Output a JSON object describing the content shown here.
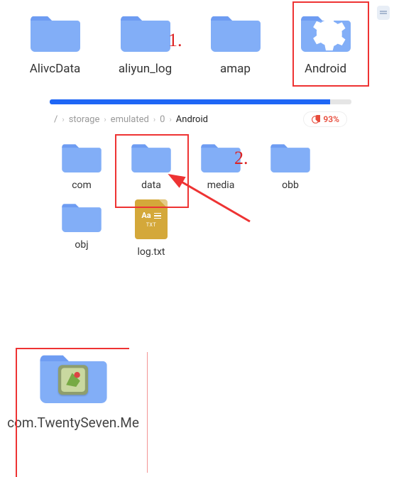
{
  "top_grid": {
    "items": [
      {
        "label": "AlivcData"
      },
      {
        "label": "aliyun_log"
      },
      {
        "label": "amap"
      },
      {
        "label": "Android"
      }
    ]
  },
  "annotations": {
    "one": "1.",
    "two": "2."
  },
  "breadcrumb": {
    "root": "/",
    "c1": "storage",
    "c2": "emulated",
    "c3": "0",
    "c4": "Android"
  },
  "storage": {
    "percent_text": "93%",
    "percent": 93
  },
  "sub_grid": {
    "items": [
      {
        "label": "com",
        "type": "folder"
      },
      {
        "label": "data",
        "type": "folder"
      },
      {
        "label": "media",
        "type": "folder"
      },
      {
        "label": "obb",
        "type": "folder"
      },
      {
        "label": "obj",
        "type": "folder"
      },
      {
        "label": "log.txt",
        "type": "txt"
      }
    ],
    "txt_badge": "TXT",
    "txt_aa": "Aa"
  },
  "bottom": {
    "label": "com.TwentySeven.Me"
  }
}
